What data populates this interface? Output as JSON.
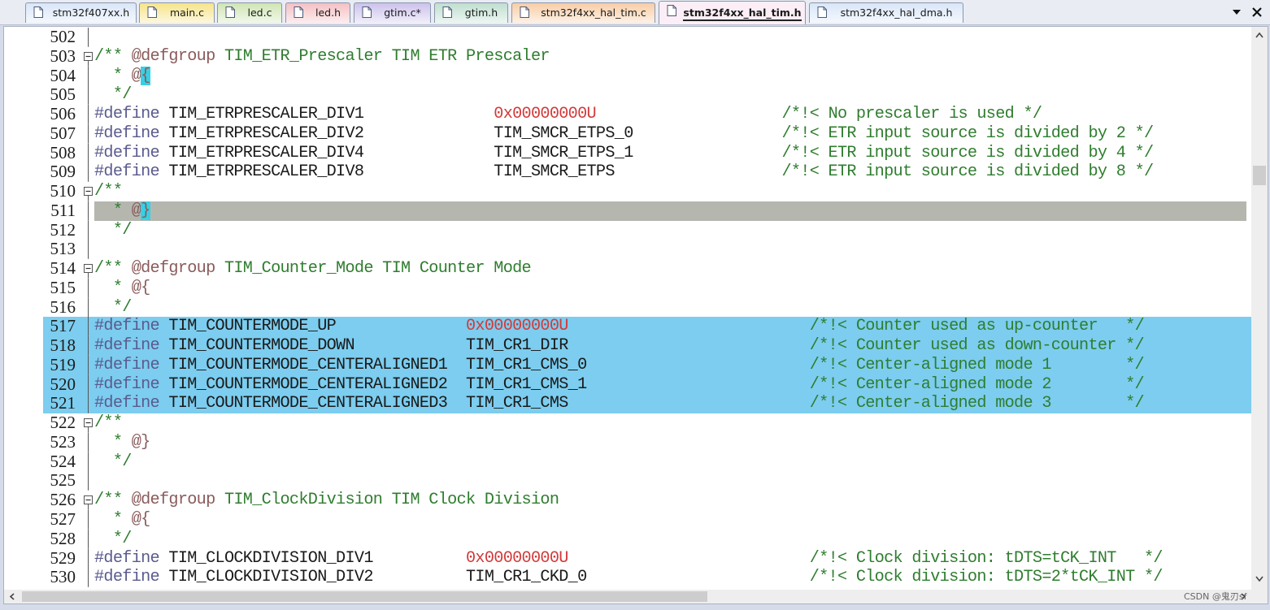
{
  "tabs": [
    {
      "label": "stm32f407xx.h",
      "color": "#d9e6f8",
      "active": false
    },
    {
      "label": "main.c",
      "color": "#f6e48a",
      "active": false
    },
    {
      "label": "led.c",
      "color": "#cfe5b4",
      "active": false
    },
    {
      "label": "led.h",
      "color": "#f4c0c4",
      "active": false
    },
    {
      "label": "gtim.c*",
      "color": "#cdc2ec",
      "active": false
    },
    {
      "label": "gtim.h",
      "color": "#bfdfcf",
      "active": false
    },
    {
      "label": "stm32f4xx_hal_tim.c",
      "color": "#f8cda6",
      "active": false
    },
    {
      "label": "stm32f4xx_hal_tim.h",
      "color": "#f4d9e8",
      "active": true
    },
    {
      "label": "stm32f4xx_hal_dma.h",
      "color": "#d9e6f8",
      "active": false
    }
  ],
  "tabbar_icons": {
    "menu": "dropdown-arrow-icon",
    "close": "close-icon"
  },
  "editor": {
    "selection_color": "#7ccdef",
    "current_line_color": "#b5b7ae",
    "lines": [
      {
        "n": "502",
        "fold": "line",
        "segs": []
      },
      {
        "n": "503",
        "fold": "open",
        "segs": [
          {
            "t": "/** ",
            "c": "cmt"
          },
          {
            "t": "@defgroup",
            "c": "dir"
          },
          {
            "t": " TIM_ETR_Prescaler TIM ETR Prescaler",
            "c": "cmt"
          }
        ]
      },
      {
        "n": "504",
        "fold": "line",
        "segs": [
          {
            "t": "  * ",
            "c": "cmt"
          },
          {
            "t": "@",
            "c": "dir"
          },
          {
            "t": "{",
            "c": "dir",
            "hl": true
          }
        ]
      },
      {
        "n": "505",
        "fold": "line",
        "segs": [
          {
            "t": "  */",
            "c": "cmt"
          }
        ]
      },
      {
        "n": "506",
        "fold": "line",
        "segs": [
          {
            "t": "#define",
            "c": "def"
          },
          {
            "t": " TIM_ETRPRESCALER_DIV1              ",
            "c": "txt"
          },
          {
            "t": "0x00000000U",
            "c": "num"
          },
          {
            "t": "                    ",
            "c": "txt"
          },
          {
            "t": "/*!< No prescaler is used */",
            "c": "cmt"
          }
        ]
      },
      {
        "n": "507",
        "fold": "line",
        "segs": [
          {
            "t": "#define",
            "c": "def"
          },
          {
            "t": " TIM_ETRPRESCALER_DIV2              TIM_SMCR_ETPS_0                ",
            "c": "txt"
          },
          {
            "t": "/*!< ETR input source is divided by 2 */",
            "c": "cmt"
          }
        ]
      },
      {
        "n": "508",
        "fold": "line",
        "segs": [
          {
            "t": "#define",
            "c": "def"
          },
          {
            "t": " TIM_ETRPRESCALER_DIV4              TIM_SMCR_ETPS_1                ",
            "c": "txt"
          },
          {
            "t": "/*!< ETR input source is divided by 4 */",
            "c": "cmt"
          }
        ]
      },
      {
        "n": "509",
        "fold": "line",
        "segs": [
          {
            "t": "#define",
            "c": "def"
          },
          {
            "t": " TIM_ETRPRESCALER_DIV8              TIM_SMCR_ETPS                  ",
            "c": "txt"
          },
          {
            "t": "/*!< ETR input source is divided by 8 */",
            "c": "cmt"
          }
        ]
      },
      {
        "n": "510",
        "fold": "open",
        "segs": [
          {
            "t": "/**",
            "c": "cmt"
          }
        ]
      },
      {
        "n": "511",
        "fold": "line",
        "current": true,
        "segs": [
          {
            "t": "  * ",
            "c": "cmt"
          },
          {
            "t": "@",
            "c": "dir"
          },
          {
            "t": "}",
            "c": "dir",
            "hl": true
          }
        ]
      },
      {
        "n": "512",
        "fold": "line",
        "segs": [
          {
            "t": "  */",
            "c": "cmt"
          }
        ]
      },
      {
        "n": "513",
        "fold": "line",
        "segs": []
      },
      {
        "n": "514",
        "fold": "open",
        "segs": [
          {
            "t": "/** ",
            "c": "cmt"
          },
          {
            "t": "@defgroup",
            "c": "dir"
          },
          {
            "t": " TIM_Counter_Mode TIM Counter Mode",
            "c": "cmt"
          }
        ]
      },
      {
        "n": "515",
        "fold": "line",
        "segs": [
          {
            "t": "  * ",
            "c": "cmt"
          },
          {
            "t": "@{",
            "c": "dir"
          }
        ]
      },
      {
        "n": "516",
        "fold": "line",
        "segs": [
          {
            "t": "  */",
            "c": "cmt"
          }
        ]
      },
      {
        "n": "517",
        "fold": "line",
        "selected": true,
        "segs": [
          {
            "t": "#define",
            "c": "def"
          },
          {
            "t": " TIM_COUNTERMODE_UP              ",
            "c": "txt"
          },
          {
            "t": "0x00000000U",
            "c": "num"
          },
          {
            "t": "                          ",
            "c": "txt"
          },
          {
            "t": "/*!< Counter used as up-counter   */",
            "c": "cmt"
          }
        ]
      },
      {
        "n": "518",
        "fold": "line",
        "selected": true,
        "segs": [
          {
            "t": "#define",
            "c": "def"
          },
          {
            "t": " TIM_COUNTERMODE_DOWN            TIM_CR1_DIR                          ",
            "c": "txt"
          },
          {
            "t": "/*!< Counter used as down-counter */",
            "c": "cmt"
          }
        ]
      },
      {
        "n": "519",
        "fold": "line",
        "selected": true,
        "segs": [
          {
            "t": "#define",
            "c": "def"
          },
          {
            "t": " TIM_COUNTERMODE_CENTERALIGNED1  TIM_CR1_CMS_0                        ",
            "c": "txt"
          },
          {
            "t": "/*!< Center-aligned mode 1        */",
            "c": "cmt"
          }
        ]
      },
      {
        "n": "520",
        "fold": "line",
        "selected": true,
        "segs": [
          {
            "t": "#define",
            "c": "def"
          },
          {
            "t": " TIM_COUNTERMODE_CENTERALIGNED2  TIM_CR1_CMS_1                        ",
            "c": "txt"
          },
          {
            "t": "/*!< Center-aligned mode 2        */",
            "c": "cmt"
          }
        ]
      },
      {
        "n": "521",
        "fold": "line",
        "selected": true,
        "segs": [
          {
            "t": "#define",
            "c": "def"
          },
          {
            "t": " TIM_COUNTERMODE_CENTERALIGNED3  TIM_CR1_CMS                          ",
            "c": "txt"
          },
          {
            "t": "/*!< Center-aligned mode 3        */",
            "c": "cmt"
          }
        ]
      },
      {
        "n": "522",
        "fold": "open",
        "segs": [
          {
            "t": "/**",
            "c": "cmt"
          }
        ]
      },
      {
        "n": "523",
        "fold": "line",
        "segs": [
          {
            "t": "  * ",
            "c": "cmt"
          },
          {
            "t": "@}",
            "c": "dir"
          }
        ]
      },
      {
        "n": "524",
        "fold": "line",
        "segs": [
          {
            "t": "  */",
            "c": "cmt"
          }
        ]
      },
      {
        "n": "525",
        "fold": "line",
        "segs": []
      },
      {
        "n": "526",
        "fold": "open",
        "segs": [
          {
            "t": "/** ",
            "c": "cmt"
          },
          {
            "t": "@defgroup",
            "c": "dir"
          },
          {
            "t": " TIM_ClockDivision TIM Clock Division",
            "c": "cmt"
          }
        ]
      },
      {
        "n": "527",
        "fold": "line",
        "segs": [
          {
            "t": "  * ",
            "c": "cmt"
          },
          {
            "t": "@{",
            "c": "dir"
          }
        ]
      },
      {
        "n": "528",
        "fold": "line",
        "segs": [
          {
            "t": "  */",
            "c": "cmt"
          }
        ]
      },
      {
        "n": "529",
        "fold": "line",
        "segs": [
          {
            "t": "#define",
            "c": "def"
          },
          {
            "t": " TIM_CLOCKDIVISION_DIV1          ",
            "c": "txt"
          },
          {
            "t": "0x00000000U",
            "c": "num"
          },
          {
            "t": "                          ",
            "c": "txt"
          },
          {
            "t": "/*!< Clock division: tDTS=tCK_INT   */",
            "c": "cmt"
          }
        ]
      },
      {
        "n": "530",
        "fold": "line",
        "segs": [
          {
            "t": "#define",
            "c": "def"
          },
          {
            "t": " TIM_CLOCKDIVISION_DIV2          TIM_CR1_CKD_0                        ",
            "c": "txt"
          },
          {
            "t": "/*!< Clock division: tDTS=2*tCK_INT */",
            "c": "cmt"
          }
        ]
      }
    ]
  },
  "scrollbar_icons": {
    "up": "scroll-up-arrow-icon",
    "down": "scroll-down-arrow-icon",
    "left": "scroll-left-arrow-icon",
    "right": "scroll-right-arrow-icon"
  },
  "watermark": "CSDN @鬼刃sf"
}
